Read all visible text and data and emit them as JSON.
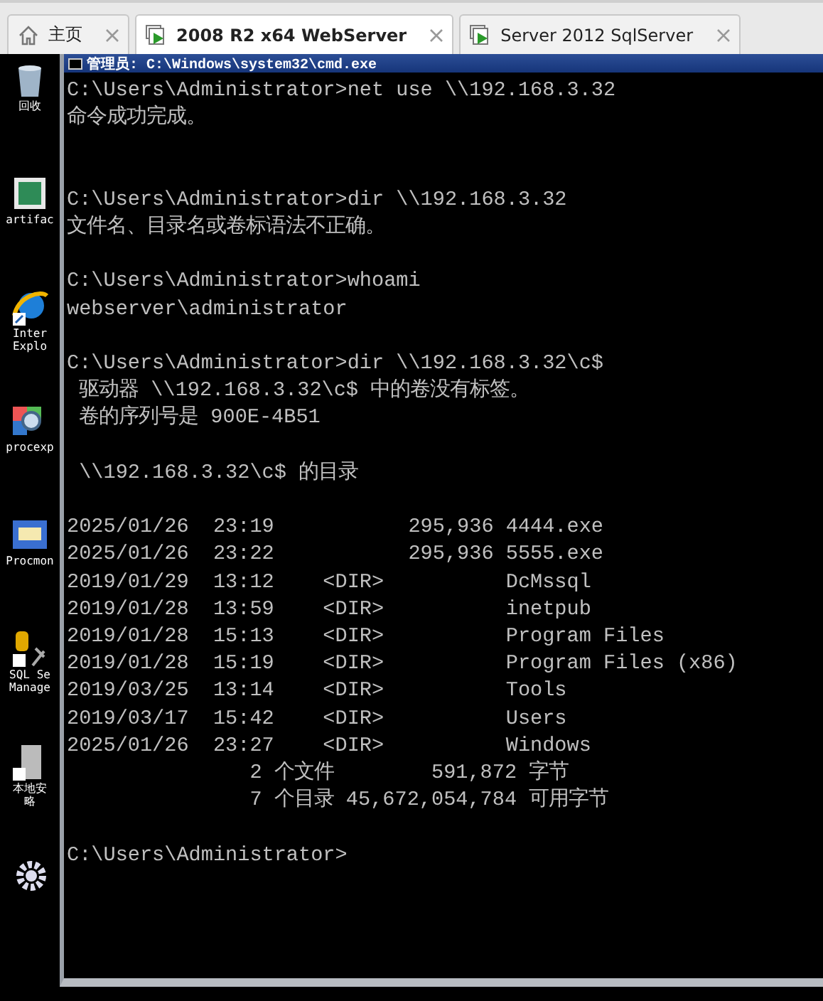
{
  "tabs": [
    {
      "kind": "home",
      "label": "主页",
      "selected": false
    },
    {
      "kind": "vm",
      "label": "2008 R2 x64 WebServer",
      "selected": true
    },
    {
      "kind": "vm",
      "label": "Server 2012 SqlServer",
      "selected": false
    }
  ],
  "desktop_icons": [
    {
      "kind": "recycle-bin",
      "label": [
        "回收"
      ]
    },
    {
      "kind": "document",
      "label": [
        "artifac"
      ]
    },
    {
      "kind": "browser",
      "label": [
        "Inter",
        "Explo"
      ]
    },
    {
      "kind": "magnifier",
      "label": [
        "procexp"
      ]
    },
    {
      "kind": "window",
      "label": [
        "Procmon"
      ]
    },
    {
      "kind": "database",
      "label": [
        "SQL Se",
        "Manage"
      ]
    },
    {
      "kind": "server",
      "label": [
        "本地安",
        "略"
      ]
    },
    {
      "kind": "gear"
    }
  ],
  "console": {
    "title": "管理员: C:\\Windows\\system32\\cmd.exe",
    "lines": [
      {
        "kind": "text",
        "text": "C:\\Users\\Administrator>net use \\\\192.168.3.32"
      },
      {
        "kind": "text",
        "text": "命令成功完成。"
      },
      {
        "kind": "blank"
      },
      {
        "kind": "blank"
      },
      {
        "kind": "text",
        "text": "C:\\Users\\Administrator>dir \\\\192.168.3.32"
      },
      {
        "kind": "text",
        "text": "文件名、目录名或卷标语法不正确。"
      },
      {
        "kind": "blank"
      },
      {
        "kind": "text",
        "text": "C:\\Users\\Administrator>whoami"
      },
      {
        "kind": "text",
        "text": "webserver\\administrator"
      },
      {
        "kind": "blank"
      },
      {
        "kind": "text",
        "text": "C:\\Users\\Administrator>dir \\\\192.168.3.32\\c$"
      },
      {
        "kind": "text",
        "text": " 驱动器 \\\\192.168.3.32\\c$ 中的卷没有标签。"
      },
      {
        "kind": "text",
        "text": " 卷的序列号是 900E-4B51"
      },
      {
        "kind": "blank"
      },
      {
        "kind": "text",
        "text": " \\\\192.168.3.32\\c$ 的目录"
      },
      {
        "kind": "blank"
      },
      {
        "kind": "text",
        "text": "2025/01/26  23:19           295,936 4444.exe"
      },
      {
        "kind": "text",
        "text": "2025/01/26  23:22           295,936 5555.exe"
      },
      {
        "kind": "text",
        "text": "2019/01/29  13:12    <DIR>          DcMssql"
      },
      {
        "kind": "text",
        "text": "2019/01/28  13:59    <DIR>          inetpub"
      },
      {
        "kind": "text",
        "text": "2019/01/28  15:13    <DIR>          Program Files"
      },
      {
        "kind": "text",
        "text": "2019/01/28  15:19    <DIR>          Program Files (x86)"
      },
      {
        "kind": "text",
        "text": "2019/03/25  13:14    <DIR>          Tools"
      },
      {
        "kind": "text",
        "text": "2019/03/17  15:42    <DIR>          Users"
      },
      {
        "kind": "text",
        "text": "2025/01/26  23:27    <DIR>          Windows"
      },
      {
        "kind": "text",
        "text": "               2 个文件        591,872 字节"
      },
      {
        "kind": "text",
        "text": "               7 个目录 45,672,054,784 可用字节"
      },
      {
        "kind": "blank"
      },
      {
        "kind": "text",
        "text": "C:\\Users\\Administrator>"
      }
    ]
  }
}
